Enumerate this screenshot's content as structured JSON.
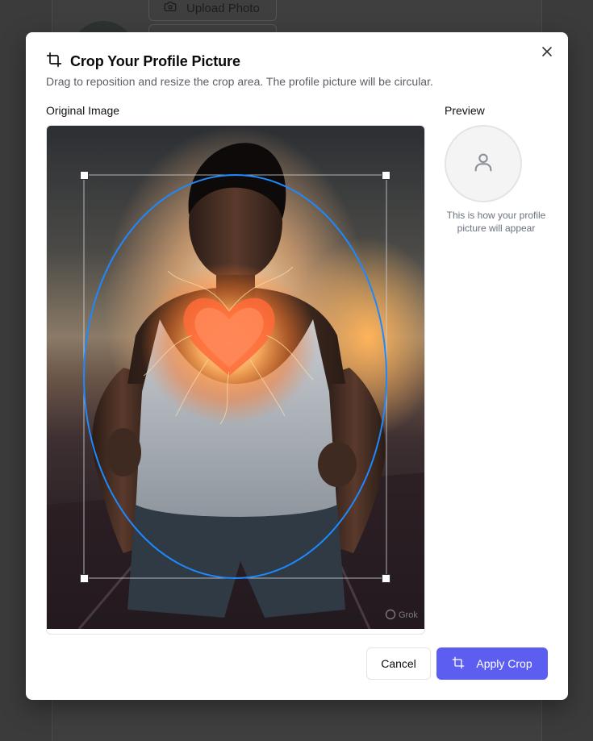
{
  "background": {
    "upload_label": "Upload Photo"
  },
  "dialog": {
    "title": "Crop Your Profile Picture",
    "subtitle": "Drag to reposition and resize the crop area. The profile picture will be circular.",
    "original_label": "Original Image",
    "preview_label": "Preview",
    "preview_note": "This is how your profile picture will appear",
    "watermark": "Grok",
    "cancel_label": "Cancel",
    "apply_label": "Apply Crop"
  },
  "colors": {
    "accent": "#5b5ef0",
    "crop_ellipse": "#1e88ff",
    "overlay": "#3b3b3b"
  }
}
